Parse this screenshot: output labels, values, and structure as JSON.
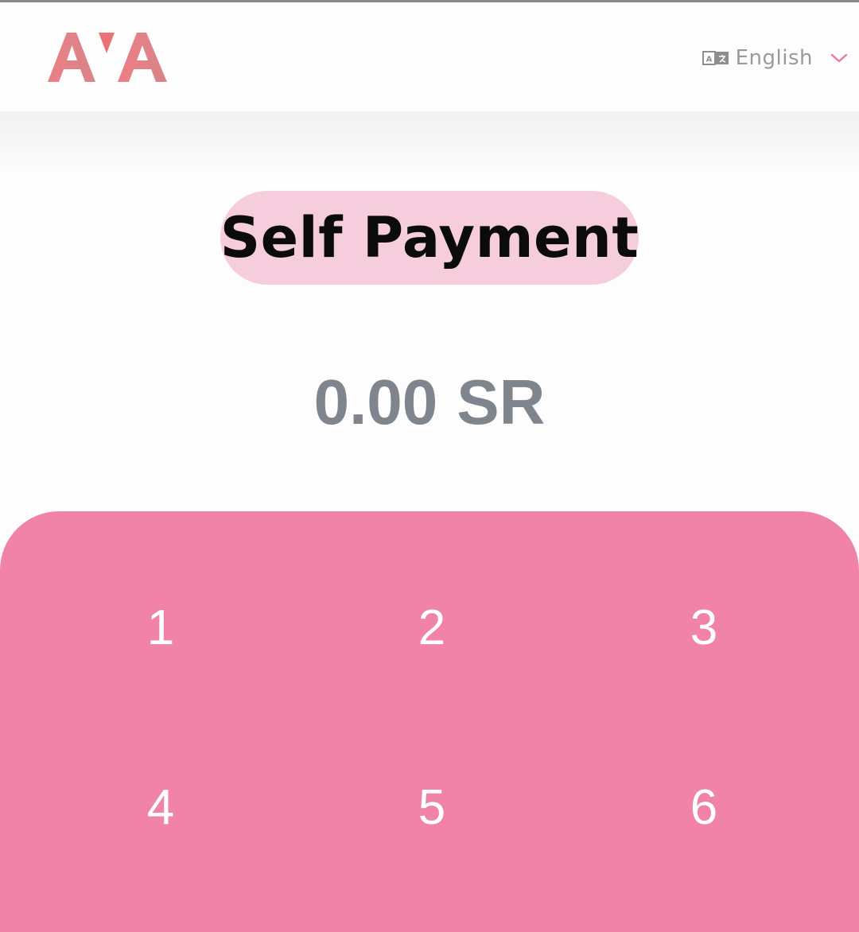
{
  "header": {
    "logo_text": "AVA",
    "language_label": "English",
    "language_icon": "translate-icon",
    "dropdown_icon": "chevron-down-icon"
  },
  "main": {
    "title": "Self Payment",
    "amount_value": "0.00",
    "amount_currency": "SR"
  },
  "keypad": {
    "keys": [
      "1",
      "2",
      "3",
      "4",
      "5",
      "6"
    ]
  },
  "colors": {
    "brand_pink": "#f083a7",
    "title_highlight": "#f6cddc",
    "logo": "#e27a84",
    "amount_text": "#7f858d"
  }
}
